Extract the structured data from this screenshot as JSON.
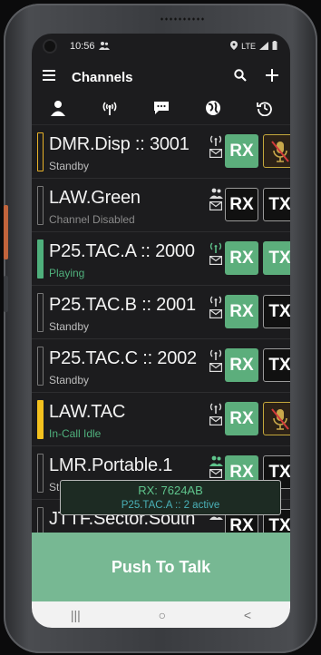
{
  "status_bar": {
    "time": "10:56",
    "network": "LTE"
  },
  "app_bar": {
    "title": "Channels"
  },
  "icon_tabs": [
    "person-icon",
    "radio-tower-icon",
    "message-icon",
    "globe-icon",
    "history-icon"
  ],
  "channels": [
    {
      "name": "DMR.Disp :: 3001",
      "state": "Standby",
      "rx": "RX",
      "tx": "",
      "bar": "amber-outline"
    },
    {
      "name": "LAW.Green",
      "state": "Channel Disabled",
      "rx": "RX",
      "tx": "TX",
      "bar": "gray"
    },
    {
      "name": "P25.TAC.A :: 2000",
      "state": "Playing",
      "rx": "RX",
      "tx": "TX",
      "bar": "green"
    },
    {
      "name": "P25.TAC.B :: 2001",
      "state": "Standby",
      "rx": "RX",
      "tx": "TX",
      "bar": "gray"
    },
    {
      "name": "P25.TAC.C :: 2002",
      "state": "Standby",
      "rx": "RX",
      "tx": "TX",
      "bar": "gray"
    },
    {
      "name": "LAW.TAC",
      "state": "In-Call Idle",
      "rx": "RX",
      "tx": "",
      "bar": "amber"
    },
    {
      "name": "LMR.Portable.1",
      "state": "Standby",
      "rx": "RX",
      "tx": "TX",
      "bar": "gray"
    },
    {
      "name": "JTTF.Sector.South",
      "state": "",
      "rx": "RX",
      "tx": "TX",
      "bar": "gray"
    }
  ],
  "toast": {
    "line1": "RX: 7624AB",
    "line2": "P25.TAC.A :: 2 active"
  },
  "ptt_label": "Push To Talk",
  "nav": {
    "recents": "|||",
    "home": "○",
    "back": "<"
  },
  "colors": {
    "accent_green": "#5cae7c",
    "amber": "#f3c11e",
    "ptt": "#77b893"
  }
}
